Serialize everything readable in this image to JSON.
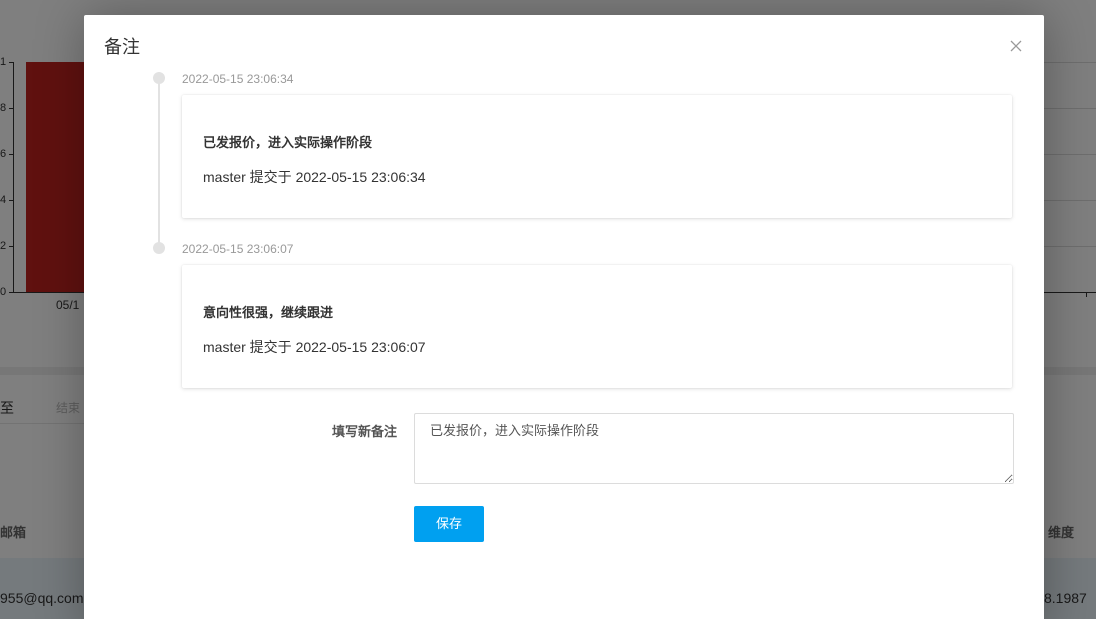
{
  "background_page": {
    "chart": {
      "y_tick_labels": [
        "1",
        "8",
        "6",
        "4",
        "2",
        "0"
      ],
      "x_tick_label": "05/1",
      "bar_color": "#c1231f"
    },
    "filter": {
      "to_label": "至",
      "end_placeholder": "结束"
    },
    "table": {
      "header_left": "邮箱",
      "header_right": "维度",
      "row_left": "955@qq.com",
      "row_right": "8.1987"
    }
  },
  "modal": {
    "title": "备注",
    "close_icon": "close-icon",
    "timeline": [
      {
        "time": "2022-05-15 23:06:34",
        "title": "已发报价，进入实际操作阶段",
        "meta": "master 提交于 2022-05-15 23:06:34"
      },
      {
        "time": "2022-05-15 23:06:07",
        "title": "意向性很强，继续跟进",
        "meta": "master 提交于 2022-05-15 23:06:07"
      }
    ],
    "form": {
      "label": "填写新备注",
      "textarea_value": "已发报价，进入实际操作阶段",
      "save_label": "保存"
    }
  },
  "colors": {
    "overlay": "rgba(0,0,0,0.5)",
    "primary_button": "#00a0f0",
    "timeline": "#e2e2e2"
  }
}
